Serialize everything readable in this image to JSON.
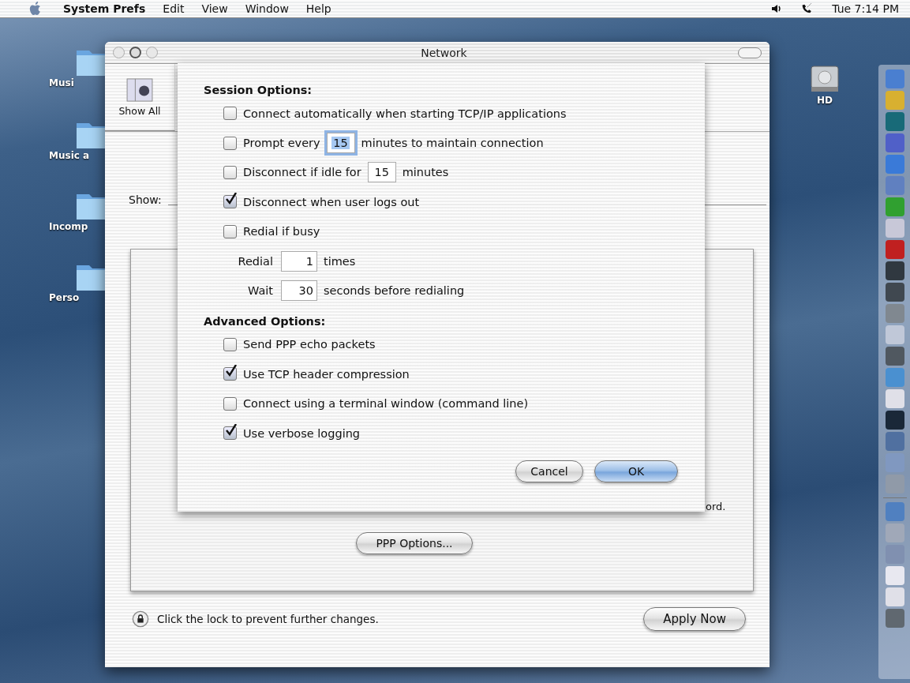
{
  "menubar": {
    "app": "System Prefs",
    "menus": [
      "Edit",
      "View",
      "Window",
      "Help"
    ],
    "clock": "Tue 7:14 PM"
  },
  "desktop_icons": [
    {
      "label": "Musi",
      "kind": "folder"
    },
    {
      "label": "Music a",
      "kind": "folder"
    },
    {
      "label": "Incomp",
      "kind": "folder"
    },
    {
      "label": "Perso",
      "kind": "folder"
    },
    {
      "label": "HD",
      "kind": "disk"
    }
  ],
  "window": {
    "title": "Network",
    "toolbar": {
      "show_all": "Show All"
    },
    "show_label": "Show:",
    "partial_text": "ord.",
    "ppp_button": "PPP Options...",
    "lock_text": "Click the lock to prevent further changes.",
    "apply_button": "Apply Now"
  },
  "sheet": {
    "sections": [
      {
        "title": "Session Options:",
        "items": [
          {
            "kind": "checkbox",
            "checked": false,
            "label": "Connect automatically when starting TCP/IP applications"
          },
          {
            "kind": "checkbox_field",
            "checked": false,
            "label": "Prompt every",
            "value": "15",
            "focused": true,
            "suffix": "minutes to maintain connection"
          },
          {
            "kind": "checkbox_field",
            "checked": false,
            "label": "Disconnect if idle for",
            "value": "15",
            "focused": false,
            "suffix": "minutes"
          },
          {
            "kind": "checkbox",
            "checked": true,
            "label": "Disconnect when user logs out"
          },
          {
            "kind": "checkbox",
            "checked": false,
            "label": "Redial if busy"
          },
          {
            "kind": "field",
            "label": "Redial",
            "value": "1",
            "suffix": "times"
          },
          {
            "kind": "field",
            "label": "Wait",
            "value": "30",
            "suffix": "seconds before redialing"
          }
        ]
      },
      {
        "title": "Advanced Options:",
        "items": [
          {
            "kind": "checkbox",
            "checked": false,
            "label": "Send PPP echo packets"
          },
          {
            "kind": "checkbox",
            "checked": true,
            "label": "Use TCP header compression"
          },
          {
            "kind": "checkbox",
            "checked": false,
            "label": "Connect using a terminal window (command line)"
          },
          {
            "kind": "checkbox",
            "checked": true,
            "label": "Use verbose logging"
          }
        ]
      }
    ],
    "buttons": [
      {
        "label": "Cancel",
        "default": false
      },
      {
        "label": "OK",
        "default": true
      }
    ]
  }
}
